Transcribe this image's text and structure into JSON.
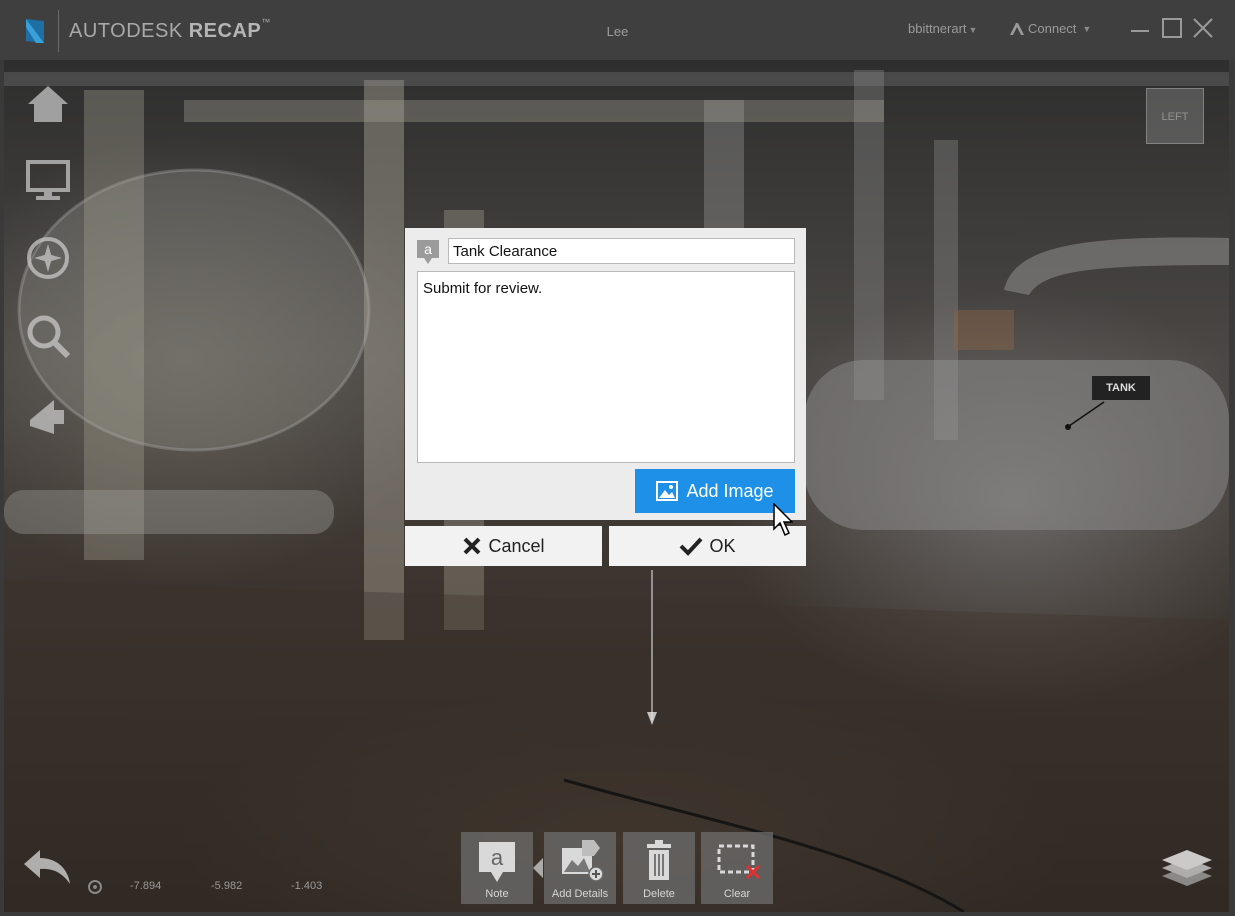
{
  "app": {
    "brand_light": "AUTODESK",
    "brand_bold": "RECAP",
    "brand_tm": "™",
    "document_title": "Lee",
    "user_menu": "bbittnerart",
    "connect_menu": "Connect"
  },
  "viewport": {
    "viewcube_label": "LEFT",
    "tank_tag": "TANK"
  },
  "dialog": {
    "title_value": "Tank Clearance",
    "body_value": "Submit for review.",
    "add_image_label": "Add Image",
    "cancel_label": "Cancel",
    "ok_label": "OK"
  },
  "toolbar": {
    "note_label": "Note",
    "add_details_label": "Add Details",
    "delete_label": "Delete",
    "clear_label": "Clear"
  },
  "status": {
    "x": "-7.894",
    "y": "-5.982",
    "z": "-1.403"
  },
  "colors": {
    "accent": "#1e90e8",
    "titlebar": "#3f3f3f",
    "dialog_bg": "#ececec"
  }
}
